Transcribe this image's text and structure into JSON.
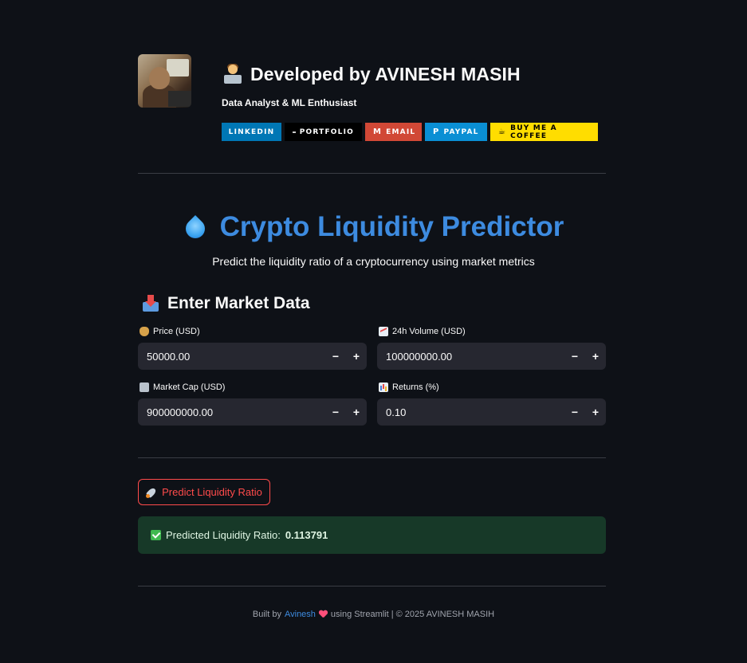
{
  "header": {
    "title": "Developed by AVINESH MASIH",
    "subtitle": "Data Analyst & ML Enthusiast",
    "badges": [
      {
        "label": "LINKEDIN",
        "color": "#0077b5"
      },
      {
        "label": "PORTFOLIO",
        "color": "#000000"
      },
      {
        "label": "EMAIL",
        "color": "#d14836"
      },
      {
        "label": "PAYPAL",
        "color": "#0a8fd4"
      },
      {
        "label": "BUY ME A COFFEE",
        "color": "#ffdd00"
      }
    ]
  },
  "main": {
    "title": "Crypto Liquidity Predictor",
    "subtitle": "Predict the liquidity ratio of a cryptocurrency using market metrics",
    "section_title": "Enter Market Data"
  },
  "fields": {
    "price": {
      "label": "Price (USD)",
      "value": "50000.00"
    },
    "volume": {
      "label": "24h Volume (USD)",
      "value": "100000000.00"
    },
    "market_cap": {
      "label": "Market Cap (USD)",
      "value": "900000000.00"
    },
    "returns": {
      "label": "Returns (%)",
      "value": "0.10"
    },
    "minus": "−",
    "plus": "+"
  },
  "predict_button": {
    "label": "Predict Liquidity Ratio"
  },
  "result": {
    "prefix": "Predicted Liquidity Ratio:",
    "value": "0.113791"
  },
  "footer": {
    "built_by": "Built by",
    "author_link": "Avinesh",
    "using": "using Streamlit | © 2025 AVINESH MASIH"
  },
  "colors": {
    "background": "#0e1117",
    "accent": "#3d8be0",
    "button_red": "#ff4b4b",
    "success_bg": "#173928"
  }
}
